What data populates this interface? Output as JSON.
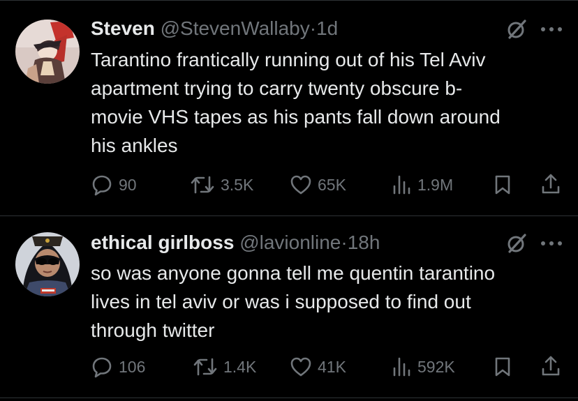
{
  "tweets": [
    {
      "name": "Steven",
      "handle": "@StevenWallaby",
      "dot": "·",
      "time": "1d",
      "text": "Tarantino frantically running out of his Tel Aviv\napartment trying to carry twenty obscure b-\nmovie VHS tapes as his pants fall down around\nhis ankles",
      "replies": "90",
      "retweets": "3.5K",
      "likes": "65K",
      "views": "1.9M",
      "icons": [
        "grok-icon",
        "more-icon",
        "reply-icon",
        "retweet-icon",
        "like-icon",
        "views-icon",
        "bookmark-icon",
        "share-icon"
      ]
    },
    {
      "name": "ethical girlboss",
      "handle": "@lavionline",
      "dot": "·",
      "time": "18h",
      "text": "so was anyone gonna tell me quentin tarantino\nlives in tel aviv or was i supposed to find out\nthrough twitter",
      "replies": "106",
      "retweets": "1.4K",
      "likes": "41K",
      "views": "592K",
      "icons": [
        "grok-icon",
        "more-icon",
        "reply-icon",
        "retweet-icon",
        "like-icon",
        "views-icon",
        "bookmark-icon",
        "share-icon"
      ]
    }
  ],
  "colors": {
    "background": "#000000",
    "text": "#e7e9ea",
    "secondary": "#71767b",
    "divider": "#2f3336"
  }
}
